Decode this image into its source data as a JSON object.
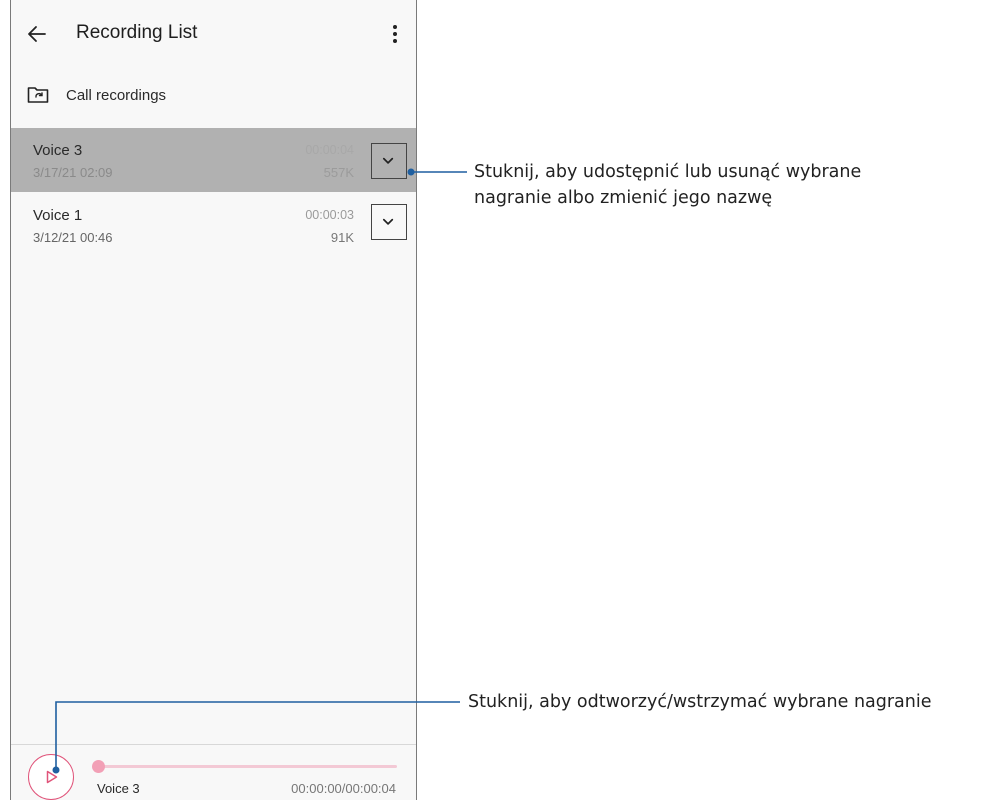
{
  "header": {
    "title": "Recording List",
    "back_icon": "arrow-left-icon",
    "more_icon": "more-vertical-icon"
  },
  "folder": {
    "icon": "folder-sync-icon",
    "label": "Call recordings"
  },
  "recordings": [
    {
      "name": "Voice 3",
      "date": "3/17/21 02:09",
      "duration": "00:00:04",
      "size": "557K",
      "selected": true
    },
    {
      "name": "Voice 1",
      "date": "3/12/21 00:46",
      "duration": "00:00:03",
      "size": "91K",
      "selected": false
    }
  ],
  "player": {
    "name": "Voice 3",
    "time": "00:00:00/00:00:04",
    "progress": 0,
    "accent_color": "#e0547a"
  },
  "annotations": {
    "expand": {
      "line1": "Stuknij, aby udostępnić lub usunąć wybrane",
      "line2": "nagranie albo zmienić jego nazwę"
    },
    "play": {
      "line1": "Stuknij, aby odtworzyć/wstrzymać wybrane nagranie"
    }
  },
  "colors": {
    "selected_row": "#b1b1b1",
    "annotation_line": "#1f5fa0"
  }
}
